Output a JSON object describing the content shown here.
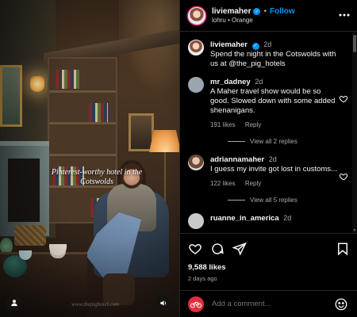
{
  "post": {
    "username": "liviemaher",
    "follow_label": "Follow",
    "subline": "lohru • Orange",
    "overlay_text": "Pinterest-worthy hotel in the Cotswolds",
    "watermark": "www.thepighotel.com"
  },
  "caption": {
    "username": "liviemaher",
    "time": "2d",
    "text": "Spend the night in the Cotswolds with us at @the_pig_hotels"
  },
  "comments": [
    {
      "username": "mr_dadney",
      "time": "2d",
      "text": "A Maher travel show would be so good. Slowed down with some added shenanigans.",
      "likes": "191 likes",
      "reply_label": "Reply",
      "view_replies": "View all 2 replies"
    },
    {
      "username": "adriannamaher",
      "time": "2d",
      "text": "I guess my invite got lost in customs...",
      "likes": "122 likes",
      "reply_label": "Reply",
      "view_replies": "View all 5 replies"
    },
    {
      "username": "ruanne_in_america",
      "time": "2d"
    }
  ],
  "stats": {
    "likes": "9,588 likes",
    "ago": "2 days ago"
  },
  "add_comment": {
    "placeholder": "Add a comment..."
  },
  "icons": {
    "heart": "heart-icon",
    "comment": "comment-icon",
    "share": "share-icon",
    "bookmark": "bookmark-icon",
    "emoji": "emoji-icon",
    "more": "more-options-icon",
    "verified": "verified-badge-icon",
    "user_tag": "user-tag-icon",
    "mute": "mute-icon"
  },
  "colors": {
    "accent": "#0095f6",
    "background": "#000000",
    "muted": "#a8a8a8"
  }
}
